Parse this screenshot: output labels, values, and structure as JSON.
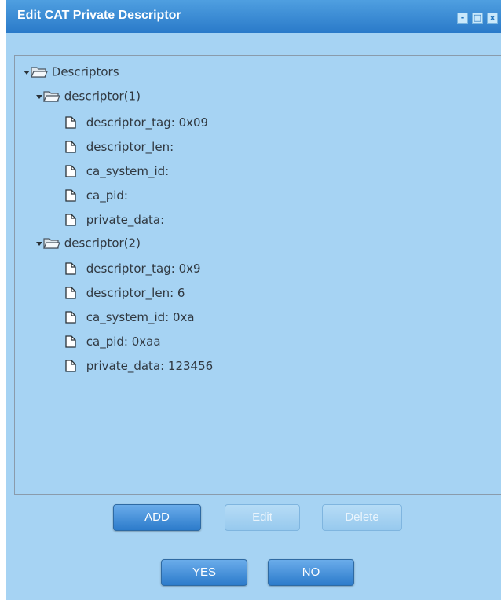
{
  "window": {
    "title": "Edit CAT Private Descriptor",
    "controls": {
      "minimize": "-",
      "maximize": "□",
      "close": "x"
    }
  },
  "tree": {
    "root": {
      "label": "Descriptors",
      "expanded": true
    },
    "descriptors": [
      {
        "label": "descriptor(1)",
        "expanded": true,
        "fields": [
          "descriptor_tag: 0x09",
          "descriptor_len:",
          "ca_system_id:",
          "ca_pid:",
          "private_data:"
        ]
      },
      {
        "label": "descriptor(2)",
        "expanded": true,
        "fields": [
          "descriptor_tag: 0x9",
          "descriptor_len: 6",
          "ca_system_id: 0xa",
          "ca_pid: 0xaa",
          "private_data: 123456"
        ]
      }
    ]
  },
  "actions": {
    "add": {
      "label": "ADD",
      "enabled": true
    },
    "edit": {
      "label": "Edit",
      "enabled": false
    },
    "delete": {
      "label": "Delete",
      "enabled": false
    }
  },
  "dialog": {
    "yes": "YES",
    "no": "NO"
  },
  "colors": {
    "titlebar": "#2a7ac9",
    "window_bg": "#a6d3f3",
    "button": "#2c7bcb",
    "text": "#303840"
  }
}
